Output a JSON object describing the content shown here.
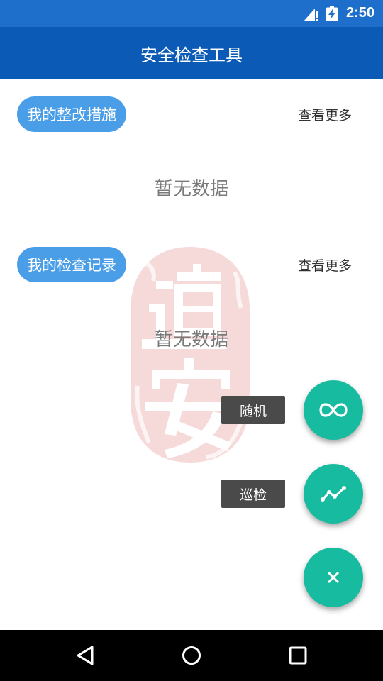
{
  "status_bar": {
    "time": "2:50",
    "icons": [
      "signal-icon",
      "battery-charging-icon"
    ]
  },
  "app_bar": {
    "title": "安全检查工具",
    "background_color": "#0b5ab5"
  },
  "sections": [
    {
      "title": "我的整改措施",
      "more_label": "查看更多",
      "empty_text": "暂无数据"
    },
    {
      "title": "我的检查记录",
      "more_label": "查看更多",
      "empty_text": "暂无数据"
    }
  ],
  "watermark": {
    "text": "道安",
    "color": "#f2c7c7"
  },
  "fab_menu": {
    "items": [
      {
        "label": "随机",
        "icon": "infinity-icon"
      },
      {
        "label": "巡检",
        "icon": "trending-icon"
      }
    ],
    "main_icon": "close-icon",
    "color": "#17bba0"
  },
  "nav_bar": {
    "icons": [
      "back-icon",
      "home-icon",
      "recents-icon"
    ]
  }
}
